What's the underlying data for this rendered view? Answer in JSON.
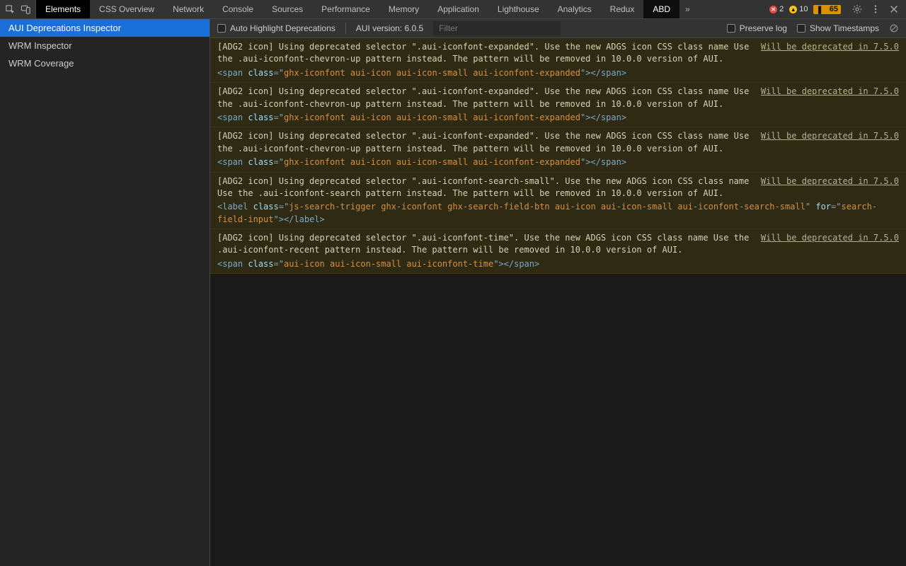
{
  "tabs": {
    "items": [
      {
        "label": "Elements",
        "highlight": true
      },
      {
        "label": "CSS Overview"
      },
      {
        "label": "Network"
      },
      {
        "label": "Console"
      },
      {
        "label": "Sources"
      },
      {
        "label": "Performance"
      },
      {
        "label": "Memory"
      },
      {
        "label": "Application"
      },
      {
        "label": "Lighthouse"
      },
      {
        "label": "Analytics"
      },
      {
        "label": "Redux"
      },
      {
        "label": "ABD",
        "active": true
      }
    ]
  },
  "status": {
    "errors": "2",
    "warnings": "10",
    "info": "65"
  },
  "sidebar": {
    "items": [
      {
        "label": "AUI Deprecations Inspector",
        "selected": true
      },
      {
        "label": "WRM Inspector"
      },
      {
        "label": "WRM Coverage"
      }
    ]
  },
  "toolbar": {
    "autoHighlight": "Auto Highlight Deprecations",
    "versionLabel": "AUI version: 6.0.5",
    "filterPlaceholder": "Filter",
    "preserveLog": "Preserve log",
    "showTimestamps": "Show Timestamps"
  },
  "depLink": "Will be deprecated in 7.5.0",
  "messages": [
    {
      "text": "[ADG2 icon] Using deprecated selector \".aui-iconfont-expanded\". Use the new ADGS icon CSS class name Use the .aui-iconfont-chevron-up pattern instead. The pattern will be removed in 10.0.0 version of AUI.",
      "snippet": {
        "tag": "span",
        "attrs": [
          [
            "class",
            "ghx-iconfont aui-icon aui-icon-small aui-iconfont-expanded"
          ]
        ]
      }
    },
    {
      "text": "[ADG2 icon] Using deprecated selector \".aui-iconfont-expanded\". Use the new ADGS icon CSS class name Use the .aui-iconfont-chevron-up pattern instead. The pattern will be removed in 10.0.0 version of AUI.",
      "snippet": {
        "tag": "span",
        "attrs": [
          [
            "class",
            "ghx-iconfont aui-icon aui-icon-small aui-iconfont-expanded"
          ]
        ]
      }
    },
    {
      "text": "[ADG2 icon] Using deprecated selector \".aui-iconfont-expanded\". Use the new ADGS icon CSS class name Use the .aui-iconfont-chevron-up pattern instead. The pattern will be removed in 10.0.0 version of AUI.",
      "snippet": {
        "tag": "span",
        "attrs": [
          [
            "class",
            "ghx-iconfont aui-icon aui-icon-small aui-iconfont-expanded"
          ]
        ]
      }
    },
    {
      "text": "[ADG2 icon] Using deprecated selector \".aui-iconfont-search-small\". Use the new ADGS icon CSS class name Use the .aui-iconfont-search pattern instead. The pattern will be removed in 10.0.0 version of AUI.",
      "snippet": {
        "tag": "label",
        "attrs": [
          [
            "class",
            "js-search-trigger ghx-iconfont ghx-search-field-btn aui-icon aui-icon-small aui-iconfont-search-small"
          ],
          [
            "for",
            "search-field-input"
          ]
        ]
      }
    },
    {
      "text": "[ADG2 icon] Using deprecated selector \".aui-iconfont-time\". Use the new ADGS icon CSS class name Use the .aui-iconfont-recent pattern instead. The pattern will be removed in 10.0.0 version of AUI.",
      "snippet": {
        "tag": "span",
        "attrs": [
          [
            "class",
            "aui-icon aui-icon-small aui-iconfont-time"
          ]
        ]
      }
    }
  ]
}
